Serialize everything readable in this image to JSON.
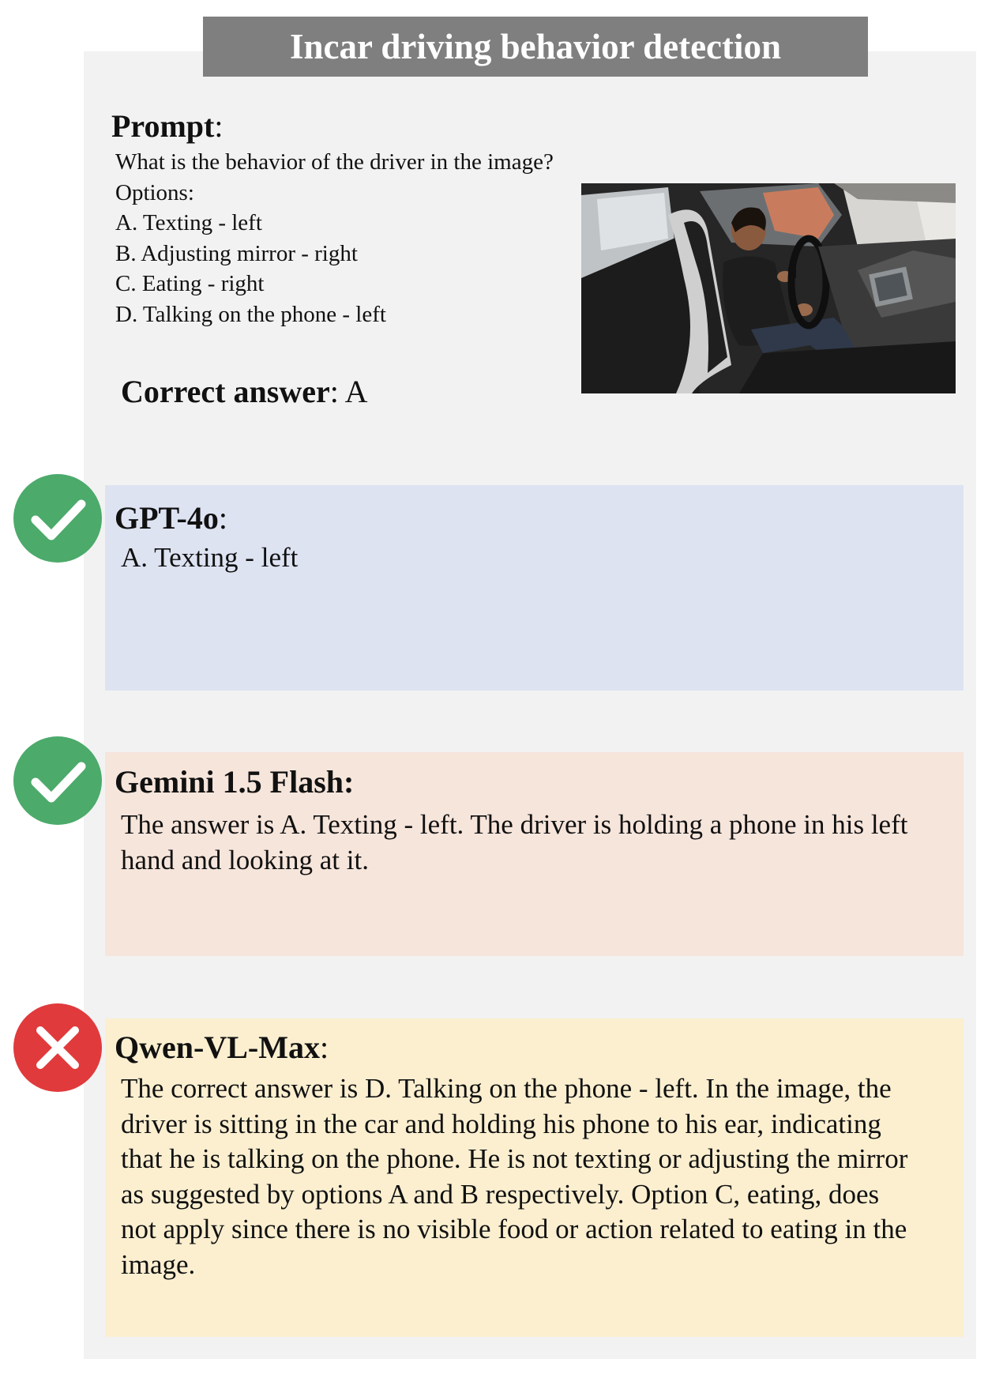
{
  "title": "Incar driving behavior detection",
  "prompt": {
    "label": "Prompt",
    "colon": ":",
    "question": "What is the behavior of the driver in the image?",
    "options_header": "Options:",
    "options": [
      "A. Texting - left",
      "B. Adjusting mirror - right",
      "C. Eating - right",
      "D. Talking on the phone - left"
    ]
  },
  "correct_answer": {
    "label": "Correct answer",
    "colon": ":",
    "value": "A"
  },
  "responses": [
    {
      "model": "GPT-4o",
      "colon": ":",
      "result": "correct",
      "answer": "A. Texting - left"
    },
    {
      "model": "Gemini 1.5 Flash:",
      "colon": "",
      "result": "correct",
      "answer": "The answer is A. Texting - left. The driver is holding a phone in his left hand and looking at it."
    },
    {
      "model": "Qwen-VL-Max",
      "colon": ":",
      "result": "incorrect",
      "answer": "The correct answer is D. Talking on the phone - left. In the image, the driver is sitting in the car and holding his phone to his ear, indicating that he is talking on the phone. He is not texting or adjusting the mirror as suggested by options A and B respectively. Option C, eating, does not apply since there is no visible food or action related to eating in the image."
    }
  ],
  "colors": {
    "title_bg": "#7f7f7f",
    "panel_bg": "#f2f2f2",
    "gpt_bg": "#dee3f2",
    "gemini_bg": "#f6e5db",
    "qwen_bg": "#fbefd0",
    "correct_mark": "#4caa6b",
    "incorrect_mark": "#e03a3c"
  },
  "icons": {
    "correct": "check-icon",
    "incorrect": "cross-icon"
  }
}
